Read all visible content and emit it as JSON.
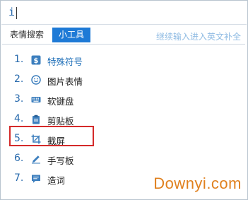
{
  "input": {
    "text": "i"
  },
  "tabs": [
    {
      "label": "表情搜索"
    },
    {
      "label": "小工具"
    }
  ],
  "hint": "继续输入进入英文补全",
  "items": [
    {
      "num": "1.",
      "label": "特殊符号",
      "icon": "dollar-icon"
    },
    {
      "num": "2.",
      "label": "图片表情",
      "icon": "smiley-icon"
    },
    {
      "num": "3.",
      "label": "软键盘",
      "icon": "keyboard-icon"
    },
    {
      "num": "4.",
      "label": "剪贴板",
      "icon": "clipboard-icon"
    },
    {
      "num": "5.",
      "label": "截屏",
      "icon": "screenshot-icon"
    },
    {
      "num": "6.",
      "label": "手写板",
      "icon": "pen-icon"
    },
    {
      "num": "7.",
      "label": "造词",
      "icon": "chat-bubble-icon"
    }
  ],
  "watermark": "Downyi.com",
  "colors": {
    "accent": "#1e7ad6",
    "highlight": "#d42a2a",
    "watermark": "#e0811f"
  }
}
